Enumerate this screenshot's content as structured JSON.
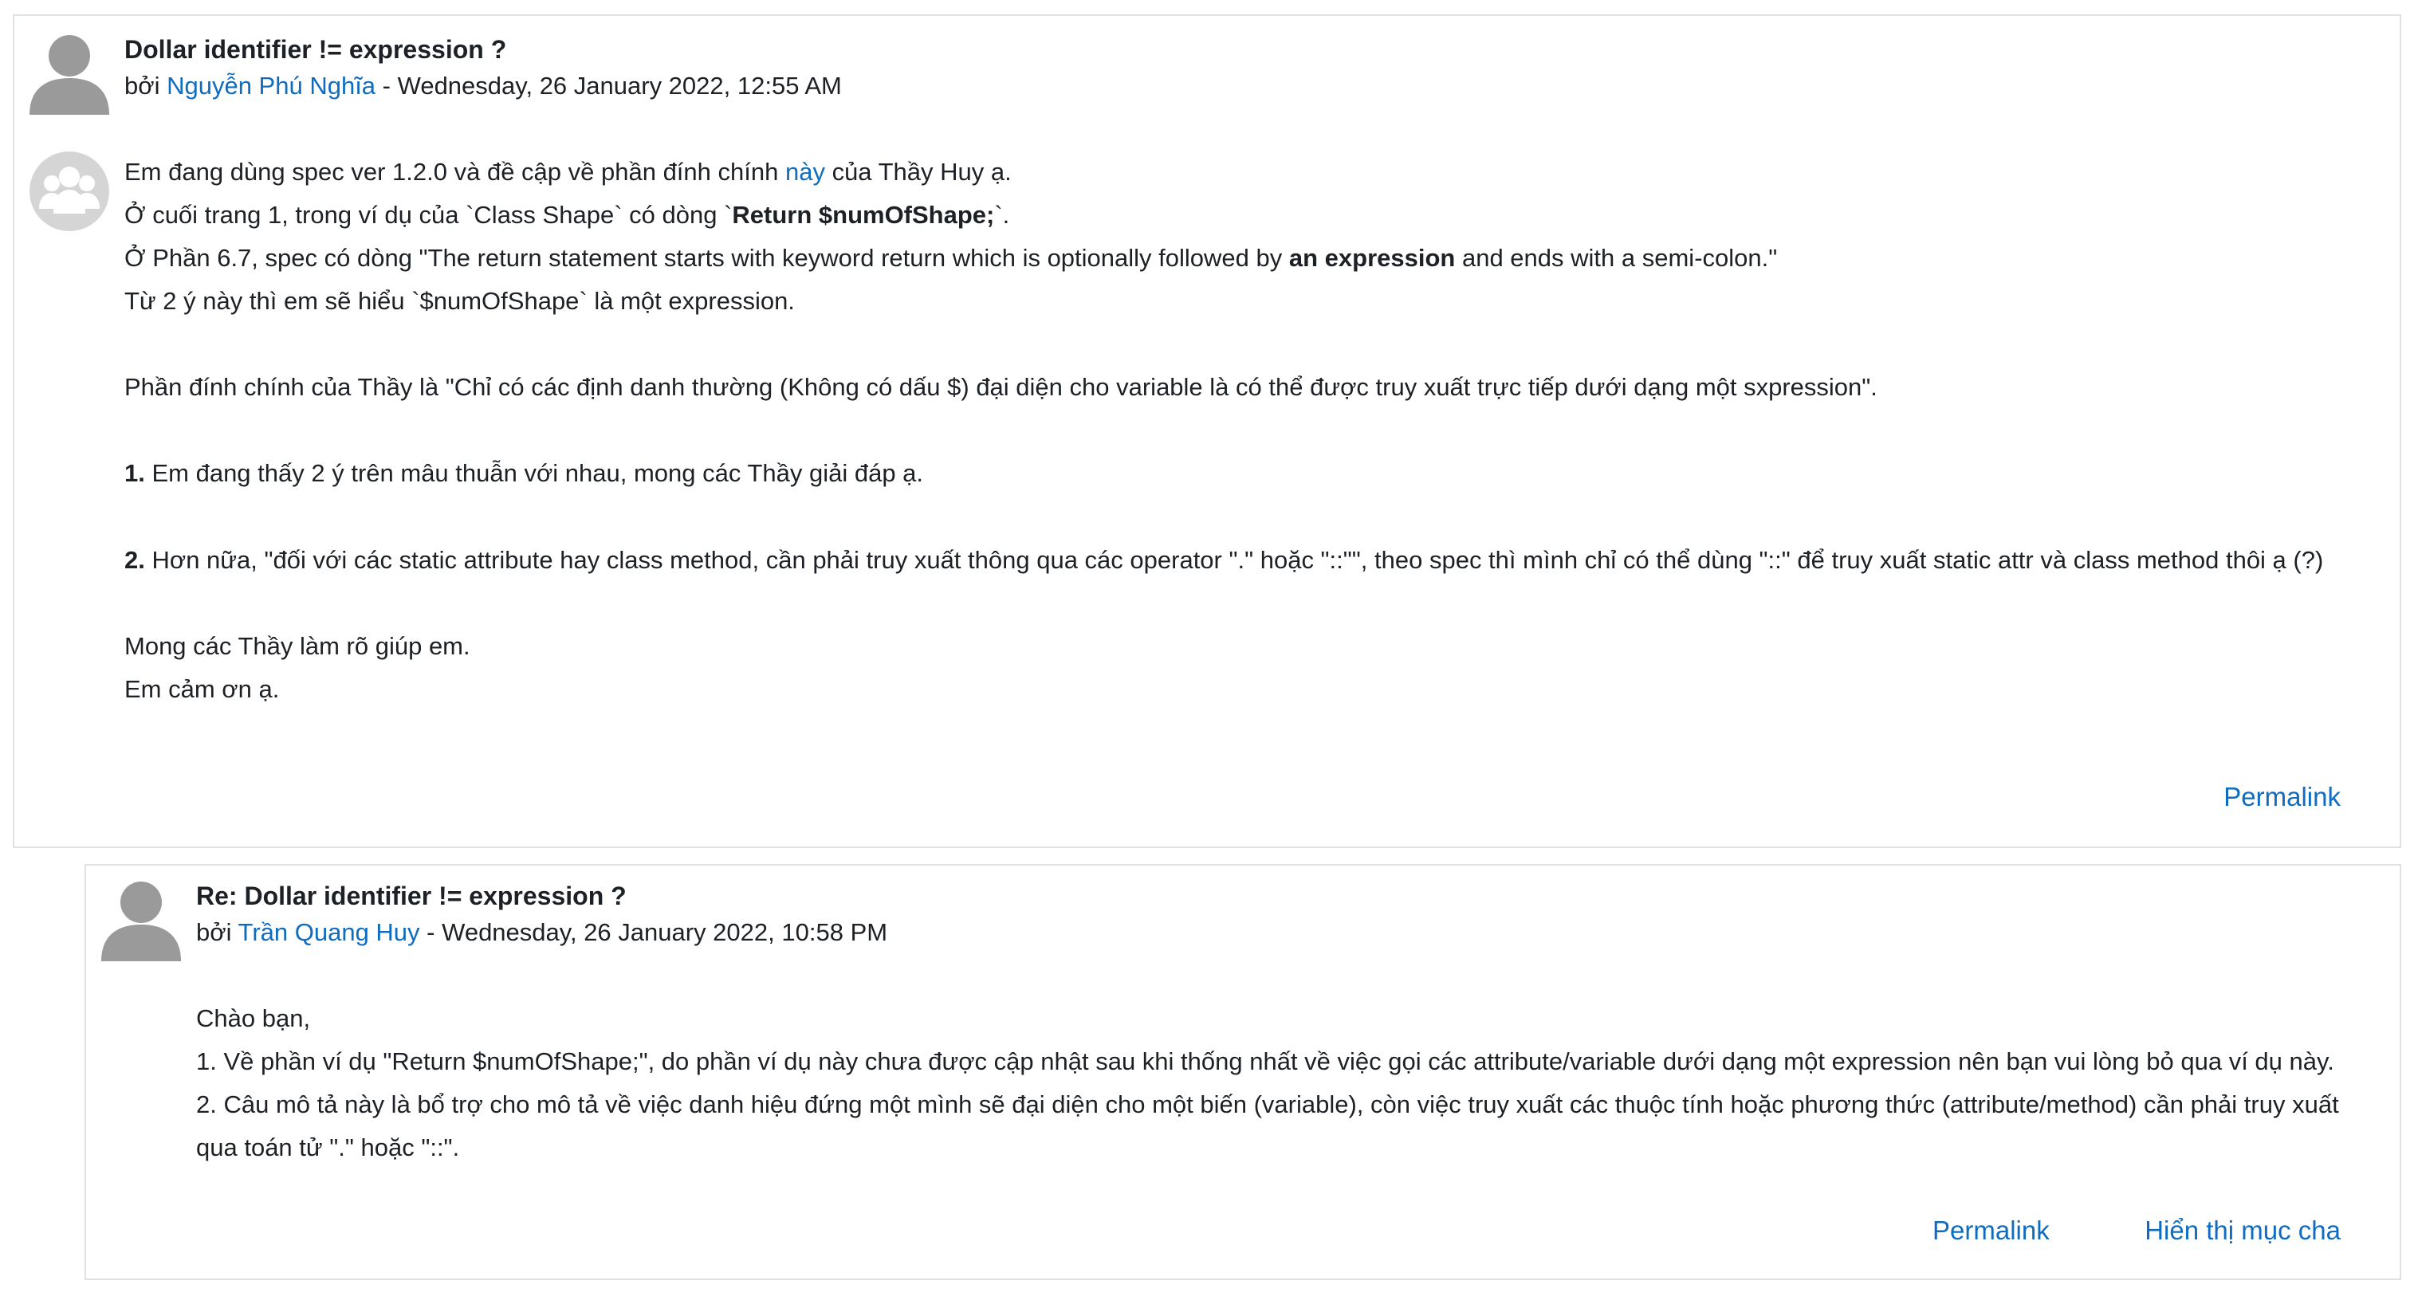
{
  "post1": {
    "subject": "Dollar identifier != expression ?",
    "by_prefix": "bởi",
    "author": "Nguyễn Phú Nghĩa",
    "date_sep": " - ",
    "date": "Wednesday, 26 January 2022, 12:55 AM",
    "l1_a": "Em đang dùng spec ver 1.2.0 và đề cập về phần đính chính ",
    "l1_link": "này",
    "l1_b": " của Thầy Huy ạ.",
    "l2_a": "Ở cuối trang 1, trong ví dụ của `Class Shape` có dòng `",
    "l2_bold": "Return $numOfShape;",
    "l2_b": "`.",
    "l3_a": "Ở Phần 6.7, spec có dòng \"The return statement starts with keyword return which is optionally followed by ",
    "l3_bold": "an expression",
    "l3_b": " and ends with a semi-colon.\"",
    "l4": "Từ 2 ý này thì em sẽ hiểu `$numOfShape` là một expression.",
    "l5": "Phần đính chính của Thầy là \"Chỉ có các định danh thường (Không có dấu $) đại diện cho variable là có thể được truy xuất trực tiếp dưới dạng một sxpression\".",
    "l6_num": "1.",
    "l6": " Em đang thấy 2 ý trên mâu thuẫn với nhau, mong các Thầy giải đáp ạ.",
    "l7_num": "2.",
    "l7": " Hơn nữa, \"đối với các static attribute hay class method, cần phải truy xuất thông qua các operator \".\" hoặc \"::\"\", theo spec thì mình chỉ có thể dùng \"::\" để truy xuất static attr và class method thôi ạ (?)",
    "l8": "Mong các Thầy làm rõ giúp em.",
    "l9": "Em cảm ơn ạ.",
    "permalink": "Permalink",
    "icons": {
      "author_avatar": "user-avatar-icon",
      "group_avatar": "group-avatar-icon"
    }
  },
  "post2": {
    "subject": "Re: Dollar identifier != expression ?",
    "by_prefix": "bởi",
    "author": "Trần Quang Huy",
    "date_sep": " - ",
    "date": "Wednesday, 26 January 2022, 10:58 PM",
    "l1": "Chào bạn,",
    "l2": "1. Về phần ví dụ \"Return $numOfShape;\", do phần ví dụ này chưa được cập nhật sau khi thống nhất về việc gọi các attribute/variable dưới dạng một expression nên bạn vui lòng bỏ qua ví dụ này.",
    "l3": "2. Câu mô tả này là bổ trợ cho mô tả về việc danh hiệu đứng một mình sẽ đại diện cho một biến (variable), còn việc truy xuất các thuộc tính hoặc phương thức (attribute/method) cần phải truy xuất",
    "l4": "qua toán tử \".\" hoặc \"::\".",
    "permalink": "Permalink",
    "show_parent": "Hiển thị mục cha",
    "icons": {
      "author_avatar": "user-avatar-icon"
    }
  },
  "colors": {
    "link": "#0f6cbf",
    "border": "#dee2e6",
    "avatar": "#9a9a9a",
    "group_avatar": "#d5d5d5"
  }
}
